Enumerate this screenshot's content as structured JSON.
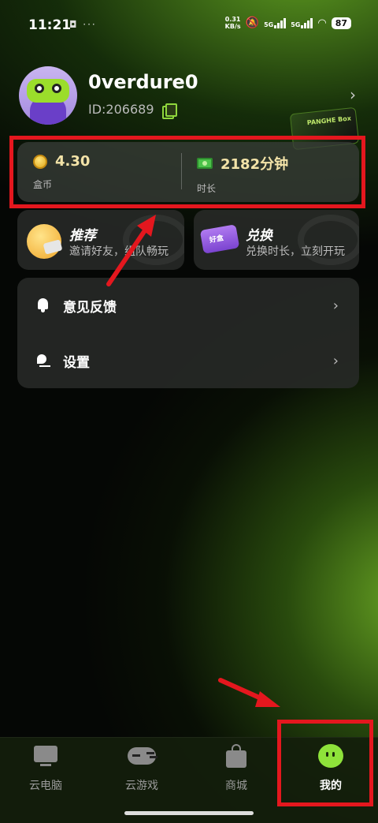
{
  "status_bar": {
    "time": "11:21",
    "misc": "◘ ···",
    "net_speed_value": "0.31",
    "net_speed_unit": "KB/s",
    "sim1": "5G",
    "sim2": "5G",
    "battery": "87"
  },
  "profile": {
    "username": "0verdure0",
    "user_id": "ID:206689",
    "box_text": "PANGHE Box"
  },
  "balance": {
    "coins_value": "4.30",
    "coins_label": "盒币",
    "time_value": "2182分钟",
    "time_label": "时长"
  },
  "features": [
    {
      "title": "推荐",
      "subtitle": "邀请好友，组队畅玩"
    },
    {
      "title": "兑换",
      "subtitle": "兑换时长，立刻开玩",
      "icon_text": "好盒"
    }
  ],
  "menu": [
    {
      "label": "意见反馈"
    },
    {
      "label": "设置"
    }
  ],
  "bottom_nav": [
    {
      "label": "云电脑"
    },
    {
      "label": "云游戏"
    },
    {
      "label": "商城"
    },
    {
      "label": "我的",
      "active": true
    }
  ],
  "colors": {
    "accent": "#8ee23a",
    "annotation": "#e4171e",
    "coin_value": "#f3e3a8"
  }
}
